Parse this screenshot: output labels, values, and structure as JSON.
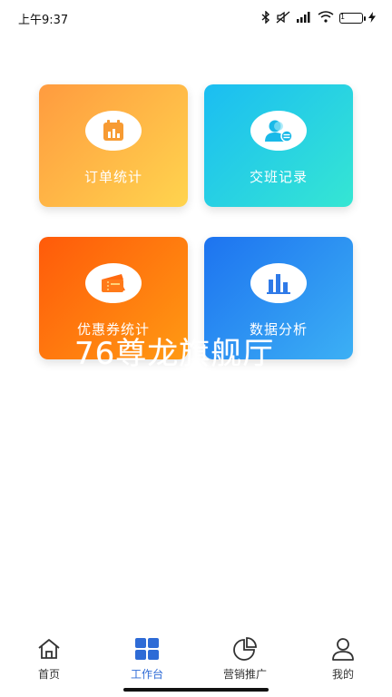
{
  "status_bar": {
    "time": "上午9:37",
    "battery_level": "1"
  },
  "cards": [
    {
      "label": "订单统计",
      "icon": "calendar-chart-icon",
      "color": "#ff9b3f"
    },
    {
      "label": "交班记录",
      "icon": "user-switch-icon",
      "color": "#1bbdf2"
    },
    {
      "label": "优惠券统计",
      "icon": "coupon-ticket-icon",
      "color": "#ff5a0a"
    },
    {
      "label": "数据分析",
      "icon": "bar-chart-icon",
      "color": "#1d73f0"
    }
  ],
  "watermark": "76尊龙旗舰厅",
  "tabbar": [
    {
      "label": "首页",
      "icon": "home-icon",
      "active": false
    },
    {
      "label": "工作台",
      "icon": "grid-icon",
      "active": true
    },
    {
      "label": "营销推广",
      "icon": "pie-chart-icon",
      "active": false
    },
    {
      "label": "我的",
      "icon": "user-icon",
      "active": false
    }
  ],
  "colors": {
    "accent": "#2e6bd6"
  }
}
